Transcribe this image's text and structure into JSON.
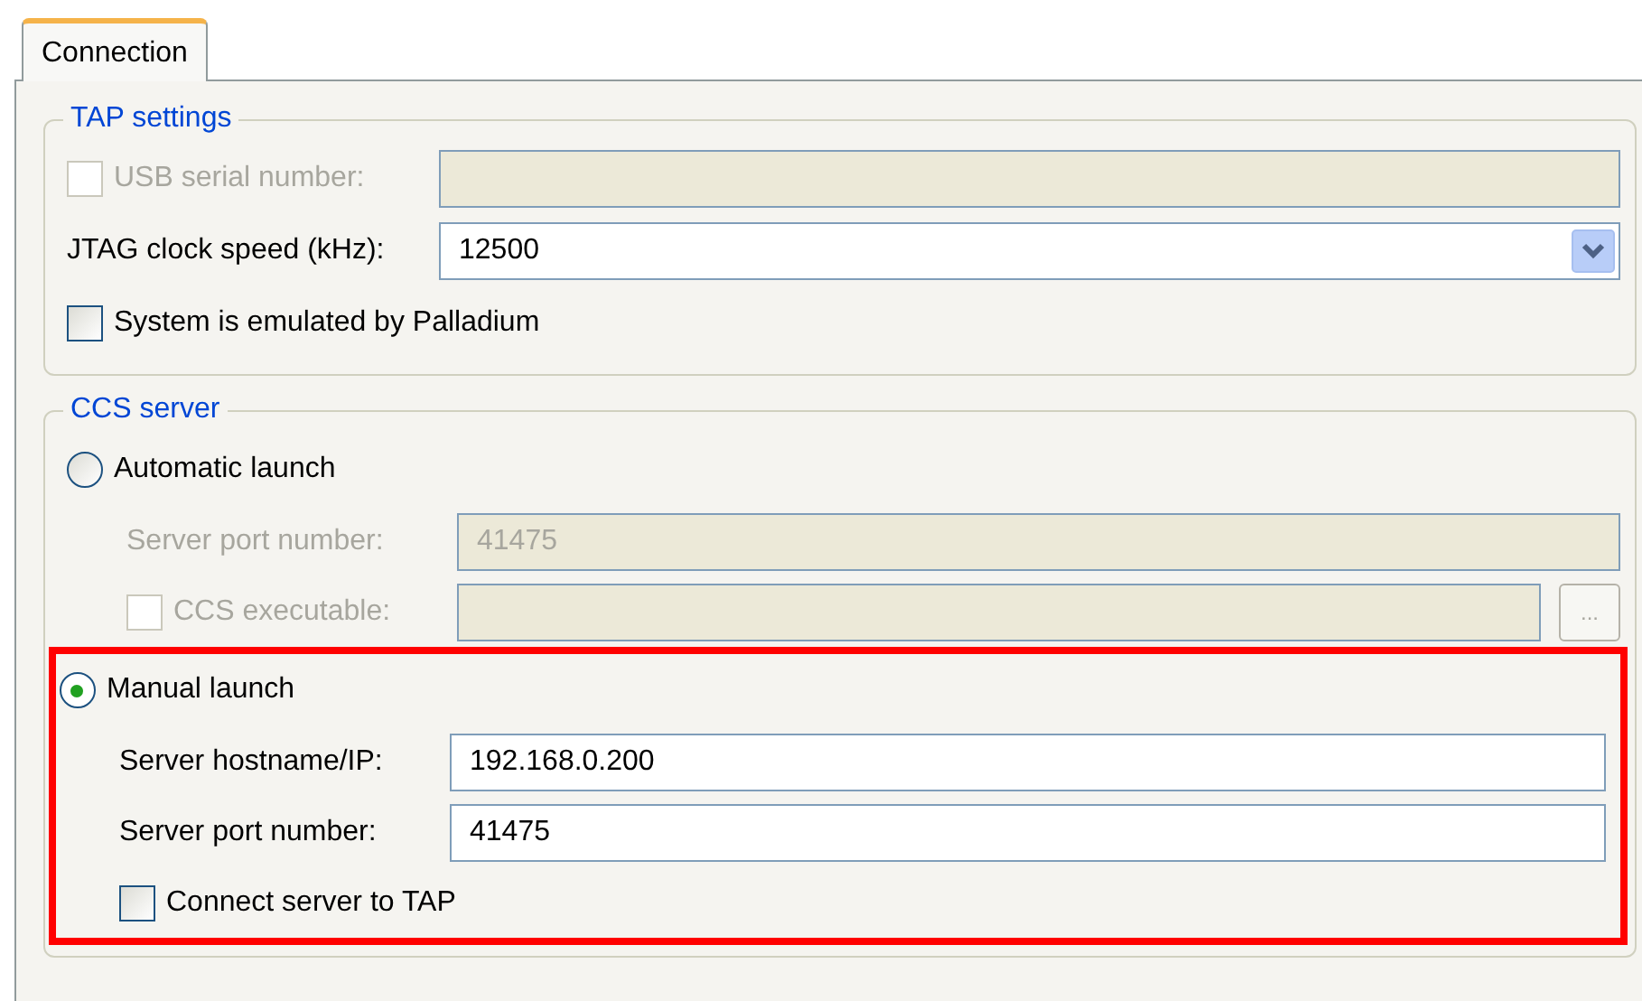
{
  "tabs": [
    {
      "label": "Connection",
      "selected": true
    }
  ],
  "tap_settings": {
    "title": "TAP settings",
    "rows": [
      {
        "kind": "check-field",
        "label": "USB serial number:",
        "checked": false,
        "disabled": true
      },
      {
        "kind": "select",
        "label": "JTAG clock speed (kHz):",
        "value": "12500",
        "disabled": false
      },
      {
        "kind": "check",
        "label": "System is emulated by Palladium",
        "checked": false,
        "disabled": false
      }
    ]
  },
  "ccs_server": {
    "title": "CCS server",
    "options": [
      {
        "label": "Automatic launch",
        "selected": false,
        "highlighted": false,
        "rows": [
          {
            "kind": "field",
            "label": "Server port number:",
            "value": "41475",
            "disabled": true
          },
          {
            "kind": "check-browse",
            "label": "CCS executable:",
            "checked": false,
            "disabled": true,
            "button": "..."
          }
        ]
      },
      {
        "label": "Manual launch",
        "selected": true,
        "highlighted": true,
        "rows": [
          {
            "kind": "field",
            "label": "Server hostname/IP:",
            "value": "192.168.0.200",
            "disabled": false
          },
          {
            "kind": "field",
            "label": "Server port number:",
            "value": "41475",
            "disabled": false
          },
          {
            "kind": "check",
            "label": "Connect server to TAP",
            "checked": false,
            "disabled": false
          }
        ]
      }
    ]
  }
}
